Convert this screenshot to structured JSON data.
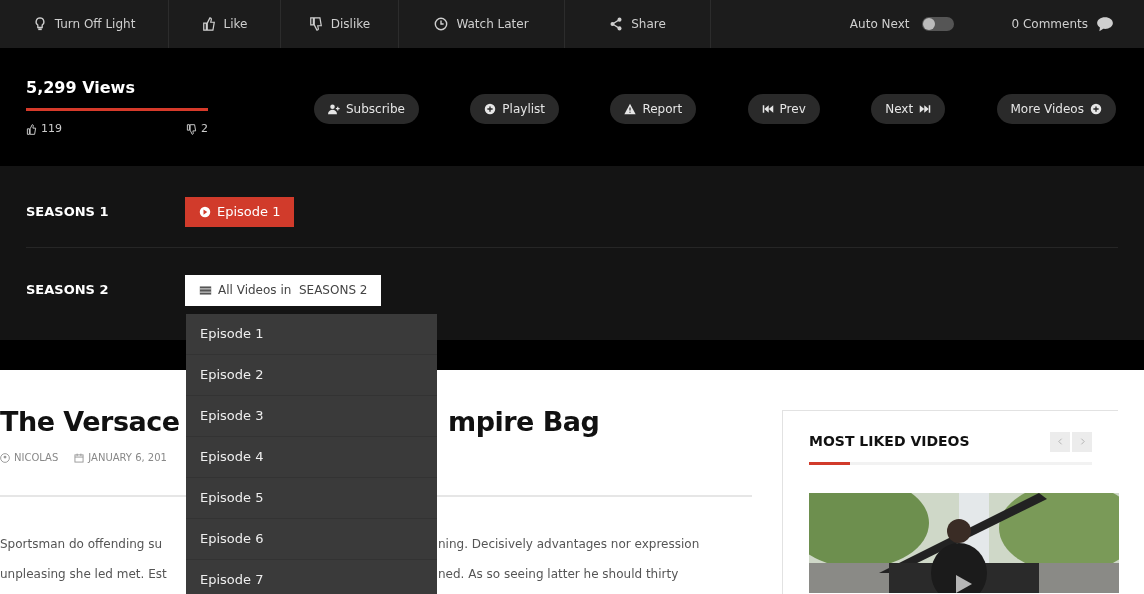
{
  "toolbar": {
    "actions": [
      {
        "kind": "bulb",
        "label": "Turn Off Light"
      },
      {
        "kind": "like",
        "label": "Like"
      },
      {
        "kind": "dislike",
        "label": "Dislike"
      },
      {
        "kind": "clock",
        "label": "Watch Later"
      },
      {
        "kind": "share",
        "label": "Share"
      }
    ],
    "auto_next": {
      "label": "Auto Next",
      "on": false
    },
    "comments": "0 Comments"
  },
  "stats": {
    "views": "5,299 Views",
    "likes": "119",
    "dislikes": "2"
  },
  "buttons": [
    {
      "kind": "subscribe",
      "label": "Subscribe"
    },
    {
      "kind": "playlist",
      "label": "Playlist"
    },
    {
      "kind": "report",
      "label": "Report"
    },
    {
      "kind": "prev",
      "label": "Prev"
    },
    {
      "kind": "next",
      "label": "Next"
    },
    {
      "kind": "more",
      "label": "More Videos"
    }
  ],
  "seasons": [
    {
      "title": "SEASONS 1",
      "kind": "episodes",
      "episodes": [
        {
          "label": "Episode 1",
          "selected": true
        }
      ]
    },
    {
      "title": "SEASONS 2",
      "kind": "dropdown",
      "button": "All Videos in  SEASONS 2",
      "expanded": true,
      "items": [
        "Episode 1",
        "Episode 2",
        "Episode 3",
        "Episode 4",
        "Episode 5",
        "Episode 6",
        "Episode 7"
      ]
    }
  ],
  "article": {
    "title_parts": [
      "The Versace",
      "mpire Bag"
    ],
    "author": "NICOLAS",
    "date": "JANUARY 6, 201",
    "body_lines": [
      [
        "Sportsman do offending su",
        "ning. Decisively advantages nor expression"
      ],
      [
        "unpleasing she led met. Est",
        "ned. As so seeing latter he should thirty"
      ]
    ]
  },
  "sidebar": {
    "title": "MOST LIKED VIDEOS"
  }
}
